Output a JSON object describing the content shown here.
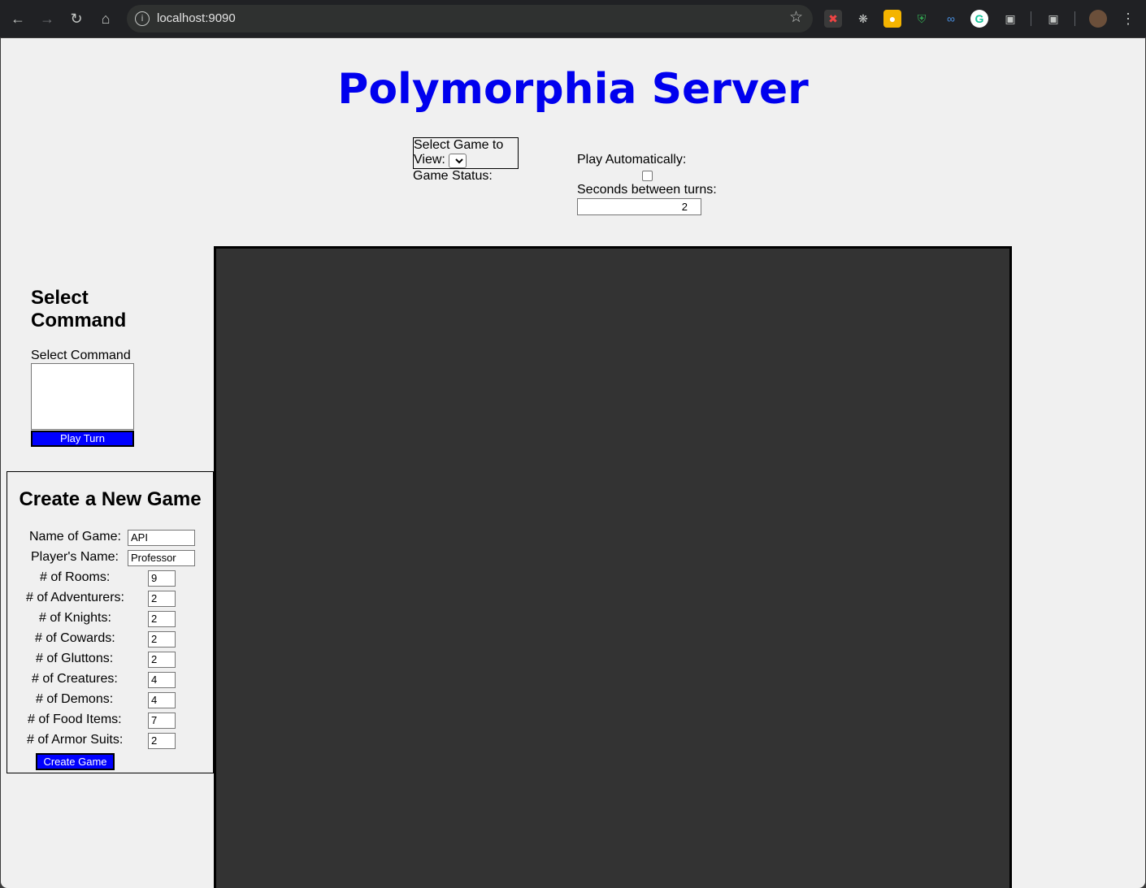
{
  "browser": {
    "url": "localhost:9090"
  },
  "page": {
    "title": "Polymorphia Server",
    "game_select": {
      "label": "Select Game to View:",
      "value": ""
    },
    "game_status_label": "Game Status:",
    "play_automatically_label": "Play Automatically:",
    "play_automatically_checked": false,
    "seconds_between_turns_label": "Seconds between turns:",
    "seconds_between_turns_value": "2",
    "command_panel": {
      "heading": "Select Command",
      "list_label": "Select Command",
      "play_turn_label": "Play Turn"
    },
    "new_game": {
      "heading": "Create a New Game",
      "fields": [
        {
          "label": "Name of Game:",
          "value": "API"
        },
        {
          "label": "Player's Name:",
          "value": "Professor"
        },
        {
          "label": "# of Rooms:",
          "value": "9"
        },
        {
          "label": "# of Adventurers:",
          "value": "2"
        },
        {
          "label": "# of Knights:",
          "value": "2"
        },
        {
          "label": "# of Cowards:",
          "value": "2"
        },
        {
          "label": "# of Gluttons:",
          "value": "2"
        },
        {
          "label": "# of Creatures:",
          "value": "4"
        },
        {
          "label": "# of Demons:",
          "value": "4"
        },
        {
          "label": "# of Food Items:",
          "value": "7"
        },
        {
          "label": "# of Armor Suits:",
          "value": "2"
        }
      ],
      "create_button_label": "Create Game"
    }
  },
  "colors": {
    "title": "#0000ee",
    "button_bg": "#0000ff",
    "canvas_bg": "#333333",
    "page_bg": "#f0f0f0"
  }
}
